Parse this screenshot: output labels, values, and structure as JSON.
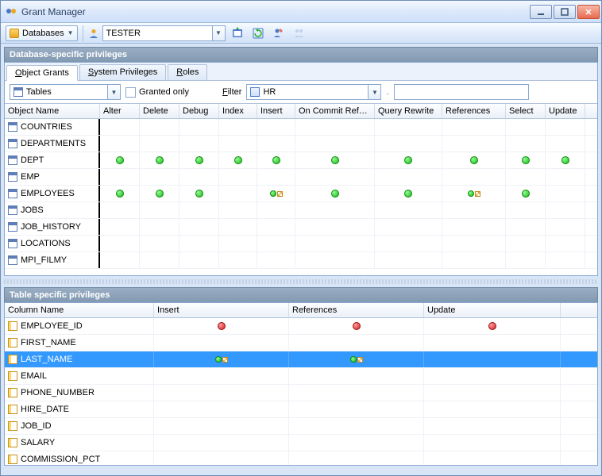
{
  "window": {
    "title": "Grant Manager"
  },
  "toolbar": {
    "databases_label": "Databases",
    "user": "TESTER"
  },
  "section1_title": "Database-specific privileges",
  "tabs": [
    {
      "label_pre": "",
      "label_u": "O",
      "label_post": "bject Grants",
      "active": true
    },
    {
      "label_pre": "",
      "label_u": "S",
      "label_post": "ystem Privileges",
      "active": false
    },
    {
      "label_pre": "",
      "label_u": "R",
      "label_post": "oles",
      "active": false
    }
  ],
  "filter": {
    "object_type": "Tables",
    "granted_only_u": "G",
    "granted_only_rest": "ranted only",
    "granted_only_checked": false,
    "filter_label_u": "F",
    "filter_label_rest": "ilter",
    "schema": "HR",
    "pattern": ""
  },
  "top_grid": {
    "columns": [
      "Object Name",
      "Alter",
      "Delete",
      "Debug",
      "Index",
      "Insert",
      "On Commit Refer...",
      "Query Rewrite",
      "References",
      "Select",
      "Update"
    ],
    "rows": [
      {
        "name": "COUNTRIES",
        "cells": [
          "",
          "",
          "",
          "",
          "",
          "",
          "",
          "",
          "",
          ""
        ]
      },
      {
        "name": "DEPARTMENTS",
        "cells": [
          "",
          "",
          "",
          "",
          "",
          "",
          "",
          "",
          "",
          ""
        ]
      },
      {
        "name": "DEPT",
        "cells": [
          "g",
          "g",
          "g",
          "g",
          "g",
          "g",
          "g",
          "g",
          "g",
          "g"
        ]
      },
      {
        "name": "EMP",
        "cells": [
          "",
          "",
          "",
          "",
          "",
          "",
          "",
          "",
          "",
          ""
        ]
      },
      {
        "name": "EMPLOYEES",
        "cells": [
          "g",
          "g",
          "g",
          "",
          "go",
          "g",
          "g",
          "go",
          "g",
          ""
        ]
      },
      {
        "name": "JOBS",
        "cells": [
          "",
          "",
          "",
          "",
          "",
          "",
          "",
          "",
          "",
          ""
        ]
      },
      {
        "name": "JOB_HISTORY",
        "cells": [
          "",
          "",
          "",
          "",
          "",
          "",
          "",
          "",
          "",
          ""
        ]
      },
      {
        "name": "LOCATIONS",
        "cells": [
          "",
          "",
          "",
          "",
          "",
          "",
          "",
          "",
          "",
          ""
        ]
      },
      {
        "name": "MPI_FILMY",
        "cells": [
          "",
          "",
          "",
          "",
          "",
          "",
          "",
          "",
          "",
          ""
        ]
      }
    ]
  },
  "section2_title": "Table specific privileges",
  "bottom_grid": {
    "columns": [
      "Column Name",
      "Insert",
      "References",
      "Update"
    ],
    "rows": [
      {
        "name": "EMPLOYEE_ID",
        "cells": [
          "r",
          "r",
          "r"
        ],
        "selected": false
      },
      {
        "name": "FIRST_NAME",
        "cells": [
          "",
          "",
          ""
        ],
        "selected": false
      },
      {
        "name": "LAST_NAME",
        "cells": [
          "go",
          "go",
          ""
        ],
        "selected": true
      },
      {
        "name": "EMAIL",
        "cells": [
          "",
          "",
          ""
        ],
        "selected": false
      },
      {
        "name": "PHONE_NUMBER",
        "cells": [
          "",
          "",
          ""
        ],
        "selected": false
      },
      {
        "name": "HIRE_DATE",
        "cells": [
          "",
          "",
          ""
        ],
        "selected": false
      },
      {
        "name": "JOB_ID",
        "cells": [
          "",
          "",
          ""
        ],
        "selected": false
      },
      {
        "name": "SALARY",
        "cells": [
          "",
          "",
          ""
        ],
        "selected": false
      },
      {
        "name": "COMMISSION_PCT",
        "cells": [
          "",
          "",
          ""
        ],
        "selected": false
      }
    ]
  }
}
